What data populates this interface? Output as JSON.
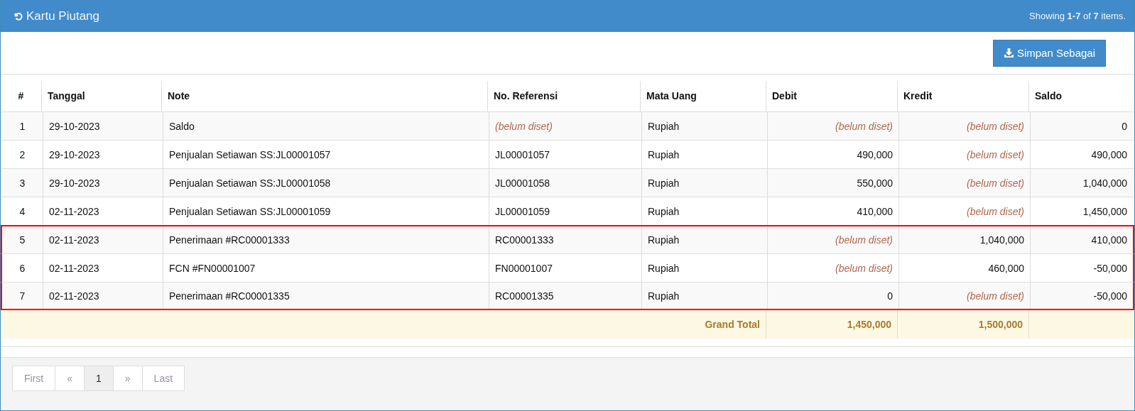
{
  "panel": {
    "title": "Kartu Piutang",
    "summary": "Showing **1-7** of **7** items."
  },
  "toolbar": {
    "export_button": "Simpan Sebagai"
  },
  "table": {
    "columns": [
      "#",
      "Tanggal",
      "Note",
      "No. Referensi",
      "Mata Uang",
      "Debit",
      "Kredit",
      "Saldo"
    ],
    "rows": [
      {
        "highlighted": false,
        "cells": [
          "1",
          "29-10-2023",
          "Saldo",
          {
            "text": "(belum diset)",
            "unset": true
          },
          "Rupiah",
          {
            "text": "(belum diset)",
            "unset": true
          },
          {
            "text": "(belum diset)",
            "unset": true
          },
          "0"
        ]
      },
      {
        "highlighted": false,
        "cells": [
          "2",
          "29-10-2023",
          "Penjualan Setiawan SS:JL00001057",
          "JL00001057",
          "Rupiah",
          "490,000",
          {
            "text": "(belum diset)",
            "unset": true
          },
          "490,000"
        ]
      },
      {
        "highlighted": false,
        "cells": [
          "3",
          "29-10-2023",
          "Penjualan Setiawan SS:JL00001058",
          "JL00001058",
          "Rupiah",
          "550,000",
          {
            "text": "(belum diset)",
            "unset": true
          },
          "1,040,000"
        ]
      },
      {
        "highlighted": false,
        "cells": [
          "4",
          "02-11-2023",
          "Penjualan Setiawan SS:JL00001059",
          "JL00001059",
          "Rupiah",
          "410,000",
          {
            "text": "(belum diset)",
            "unset": true
          },
          "1,450,000"
        ]
      },
      {
        "highlighted": true,
        "cells": [
          "5",
          "02-11-2023",
          "Penerimaan #RC00001333",
          "RC00001333",
          "Rupiah",
          {
            "text": "(belum diset)",
            "unset": true
          },
          "1,040,000",
          "410,000"
        ]
      },
      {
        "highlighted": true,
        "cells": [
          "6",
          "02-11-2023",
          "FCN #FN00001007",
          "FN00001007",
          "Rupiah",
          {
            "text": "(belum diset)",
            "unset": true
          },
          "460,000",
          "-50,000"
        ]
      },
      {
        "highlighted": true,
        "cells": [
          "7",
          "02-11-2023",
          "Penerimaan #RC00001335",
          "RC00001335",
          "Rupiah",
          "0",
          {
            "text": "(belum diset)",
            "unset": true
          },
          "-50,000"
        ]
      }
    ],
    "footer": {
      "label": "Grand Total",
      "debit": "1,450,000",
      "credit": "1,500,000"
    }
  },
  "pagination": [
    {
      "label": "First",
      "selected": false,
      "disabled": true
    },
    {
      "label": "«",
      "selected": false,
      "disabled": true
    },
    {
      "label": "1",
      "selected": true,
      "disabled": false
    },
    {
      "label": "»",
      "selected": false,
      "disabled": true
    },
    {
      "label": "Last",
      "selected": false,
      "disabled": true
    }
  ]
}
